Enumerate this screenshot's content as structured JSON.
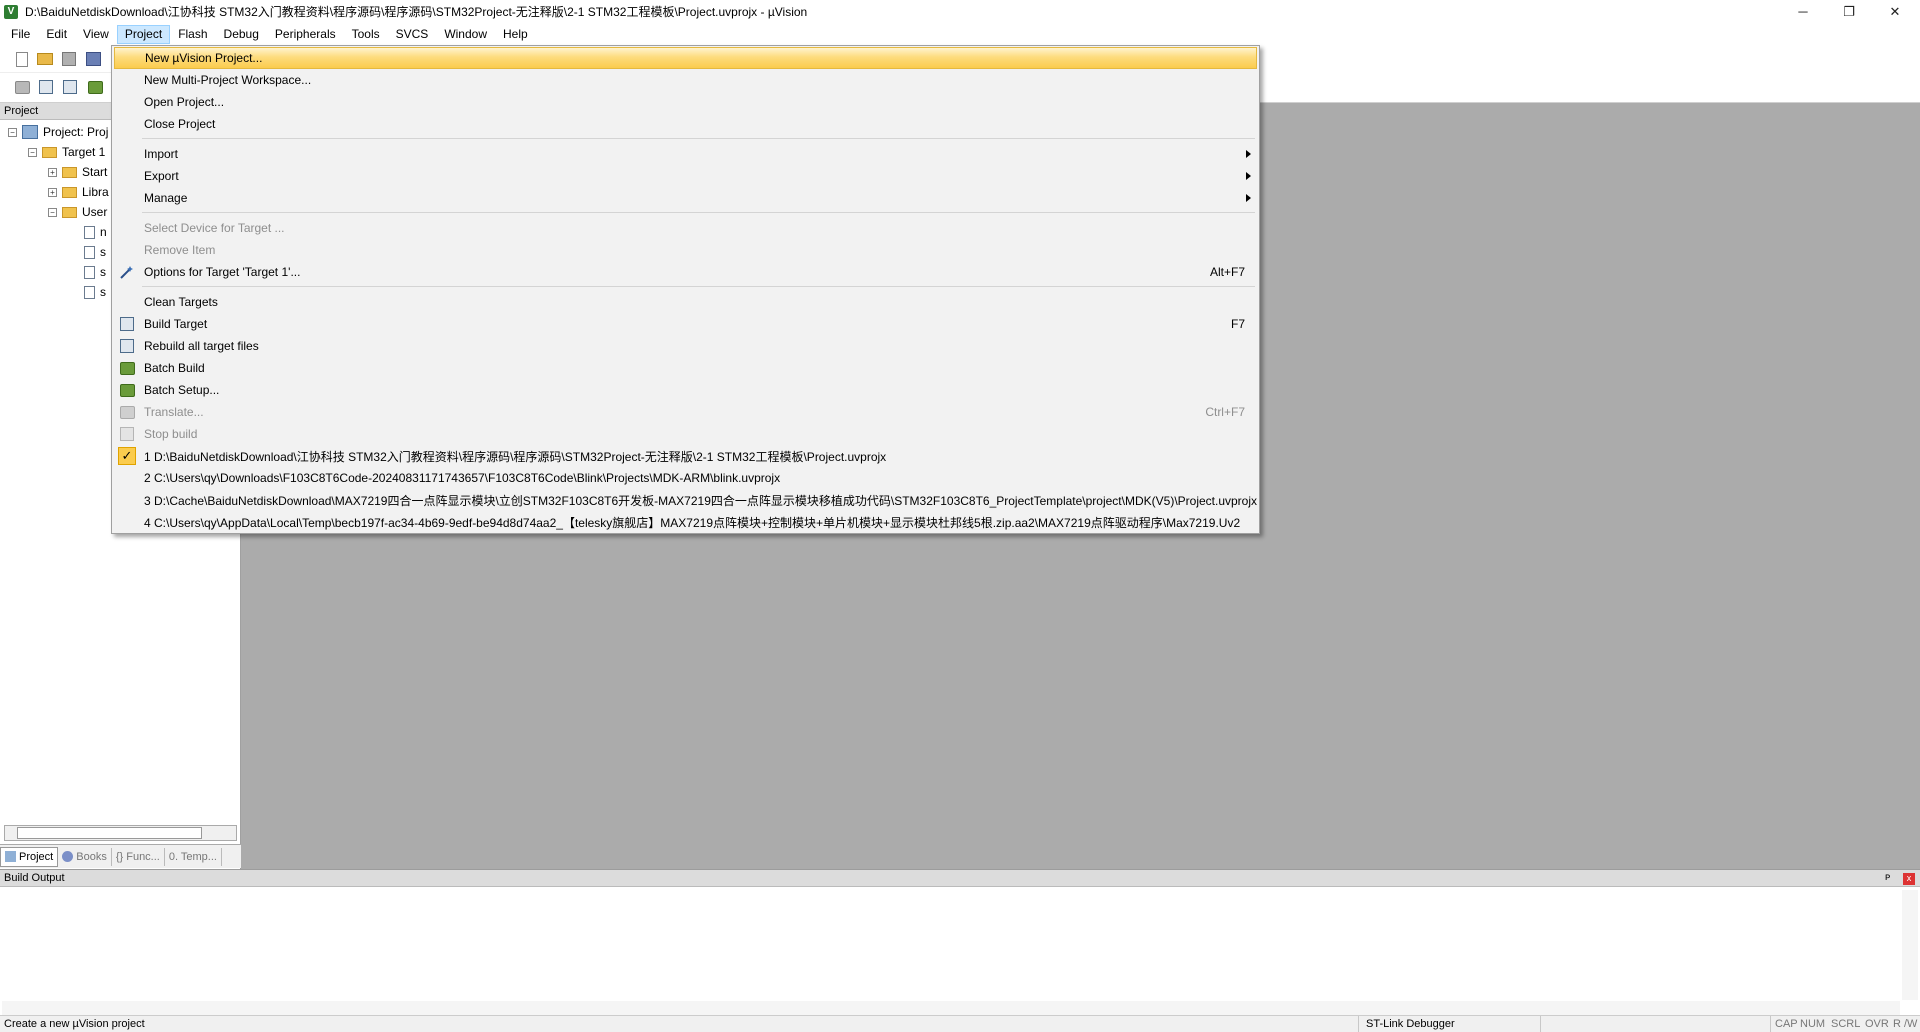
{
  "window": {
    "title": "D:\\BaiduNetdiskDownload\\江协科技 STM32入门教程资料\\程序源码\\程序源码\\STM32Project-无注释版\\2-1 STM32工程模板\\Project.uvprojx - µVision",
    "app_icon_letter": "V",
    "minimize": "─",
    "restore": "❐",
    "close": "✕"
  },
  "menubar": {
    "items": [
      "File",
      "Edit",
      "View",
      "Project",
      "Flash",
      "Debug",
      "Peripherals",
      "Tools",
      "SVCS",
      "Window",
      "Help"
    ],
    "active": "Project"
  },
  "project_panel": {
    "header": "Project",
    "tree": {
      "root": "Project: Proj",
      "target": "Target 1",
      "groups": [
        "Start",
        "Libra",
        "User"
      ],
      "user_files": [
        "n",
        "s",
        "s",
        "s"
      ]
    },
    "tabs": [
      "Project",
      "Books",
      "{} Func...",
      "0. Temp..."
    ]
  },
  "project_menu": {
    "items": [
      {
        "label": "New µVision Project...",
        "highlighted": true
      },
      {
        "label": "New Multi-Project Workspace..."
      },
      {
        "label": "Open Project..."
      },
      {
        "label": "Close Project"
      },
      {
        "label": "Import",
        "submenu": true
      },
      {
        "label": "Export",
        "submenu": true
      },
      {
        "label": "Manage",
        "submenu": true
      },
      {
        "label": "Select Device for Target ...",
        "disabled": true
      },
      {
        "label": "Remove Item",
        "disabled": true
      },
      {
        "label": "Options for Target 'Target 1'...",
        "shortcut": "Alt+F7",
        "icon": "options-wand-icon"
      },
      {
        "label": "Clean Targets"
      },
      {
        "label": "Build Target",
        "shortcut": "F7",
        "icon": "build-icon"
      },
      {
        "label": "Rebuild all target files",
        "icon": "rebuild-icon"
      },
      {
        "label": "Batch Build",
        "icon": "batch-build-icon"
      },
      {
        "label": "Batch Setup...",
        "icon": "batch-setup-icon"
      },
      {
        "label": "Translate...",
        "shortcut": "Ctrl+F7",
        "disabled": true,
        "icon": "translate-icon"
      },
      {
        "label": "Stop build",
        "disabled": true,
        "icon": "stop-build-icon"
      }
    ],
    "recent": [
      "1 D:\\BaiduNetdiskDownload\\江协科技 STM32入门教程资料\\程序源码\\程序源码\\STM32Project-无注释版\\2-1 STM32工程模板\\Project.uvprojx",
      "2 C:\\Users\\qy\\Downloads\\F103C8T6Code-20240831171743657\\F103C8T6Code\\Blink\\Projects\\MDK-ARM\\blink.uvprojx",
      "3 D:\\Cache\\BaiduNetdiskDownload\\MAX7219四合一点阵显示模块\\立创STM32F103C8T6开发板-MAX7219四合一点阵显示模块移植成功代码\\STM32F103C8T6_ProjectTemplate\\project\\MDK(V5)\\Project.uvprojx",
      "4 C:\\Users\\qy\\AppData\\Local\\Temp\\becb197f-ac34-4b69-9edf-be94d8d74aa2_【telesky旗舰店】MAX7219点阵模块+控制模块+单片机模块+显示模块杜邦线5根.zip.aa2\\MAX7219点阵驱动程序\\Max7219.Uv2"
    ],
    "recent_checked_index": 0
  },
  "build_output": {
    "header": "Build Output",
    "pin": "ᴘ",
    "close": "x"
  },
  "statusbar": {
    "message": "Create a new µVision project",
    "debugger": "ST-Link Debugger",
    "indicators": [
      "CAP",
      "NUM",
      "SCRL",
      "OVR",
      "R /W"
    ]
  },
  "colors": {
    "highlight_start": "#fff3cf",
    "highlight_end": "#fbcc4e",
    "editor_bg": "#ababab",
    "menu_bg": "#f2f2f2"
  }
}
